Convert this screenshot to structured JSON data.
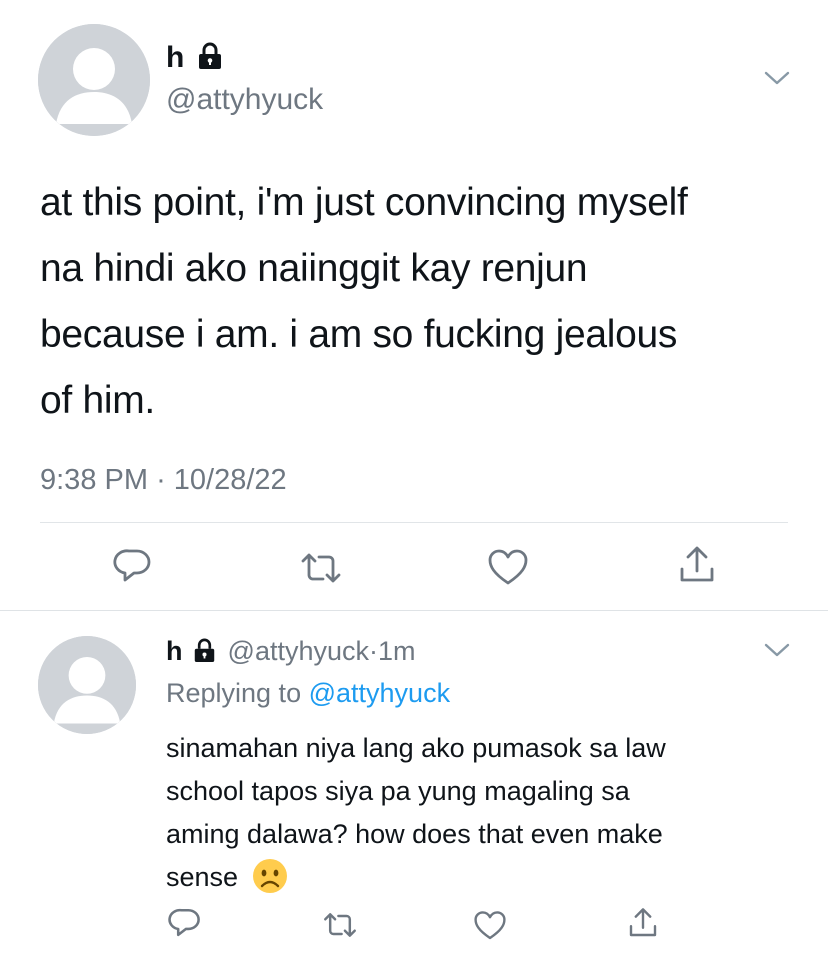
{
  "main_tweet": {
    "display_name": "h",
    "handle": "@attyhyuck",
    "text_lines": [
      "at this point, i'm just convincing myself",
      "na hindi ako naiinggit kay renjun",
      "because i am. i am so fucking jealous",
      "of him."
    ],
    "time": "9:38 PM",
    "separator": "·",
    "date": "10/28/22"
  },
  "reply": {
    "display_name": "h",
    "handle": "@attyhyuck",
    "separator": "·",
    "age": "1m",
    "replying_prefix": "Replying to",
    "replying_handle": "@attyhyuck",
    "text_lines": [
      "sinamahan niya lang ako pumasok sa law",
      "school tapos siya pa yung magaling sa",
      "aming dalawa? how does that even make",
      "sense"
    ],
    "emoji": "☹"
  },
  "icons": {
    "reply": "reply-icon",
    "retweet": "retweet-icon",
    "like": "like-icon",
    "share": "share-icon",
    "lock": "lock-icon",
    "more": "chevron-down-icon"
  },
  "colors": {
    "text": "#0f1419",
    "secondary": "#6e7781",
    "accent": "#1d9bf0",
    "avatar": "#cfd3d8"
  }
}
